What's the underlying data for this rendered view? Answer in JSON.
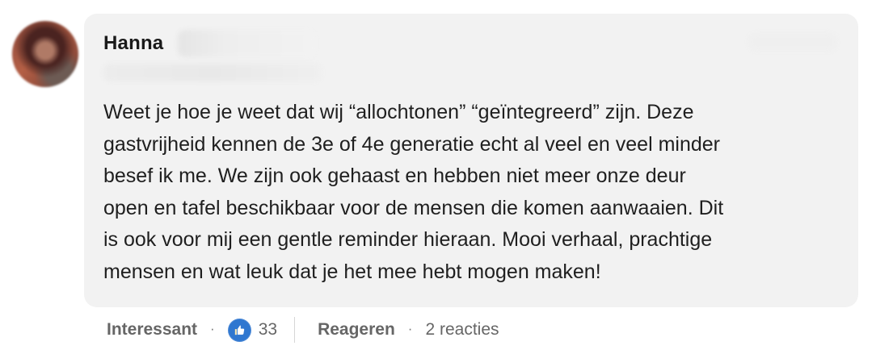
{
  "comment": {
    "author": {
      "name": "Hanna"
    },
    "text": "Weet je hoe je weet dat wij “allochtonen” “geïntegreerd” zijn. Deze\ngastvrijheid kennen de 3e of 4e generatie echt al veel en veel minder\nbesef ik me. We zijn ook gehaast en hebben niet meer onze deur\nopen en tafel beschikbaar voor de mensen die komen aanwaaien. Dit\nis ook voor mij een gentle reminder hieraan. Mooi verhaal, prachtige\nmensen en wat leuk dat je het mee hebt mogen maken!"
  },
  "actions": {
    "interessant_label": "Interessant",
    "separator": "·",
    "reaction_icon": "thumbs-up-icon",
    "reaction_count": "33",
    "reply_label": "Reageren",
    "replies_label": "2 reacties"
  },
  "colors": {
    "bubble_background": "#f2f2f2",
    "text": "#1f1f1f",
    "secondary_text": "#666666",
    "reaction_blue": "#2f77d0"
  }
}
